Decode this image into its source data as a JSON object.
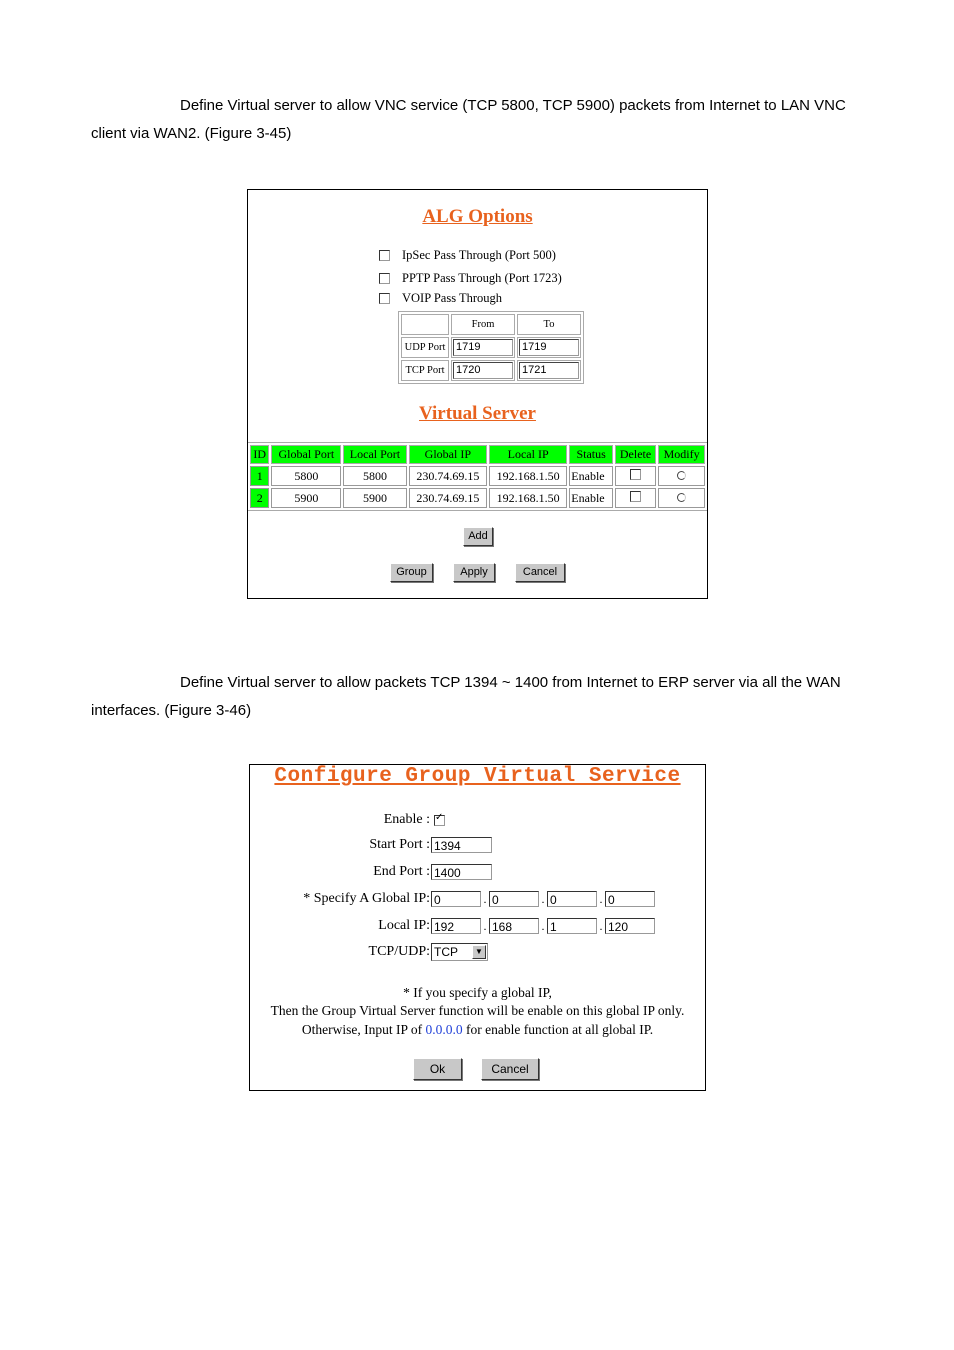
{
  "paragraphs": {
    "p1": "Define Virtual server to allow VNC service (TCP 5800, TCP 5900) packets from Internet to LAN VNC client via WAN2. (Figure 3-45)",
    "p2": "Define Virtual server to allow packets TCP 1394 ~ 1400 from Internet to ERP server via all the WAN interfaces. (Figure 3-46)"
  },
  "figure1": {
    "alg_title": "ALG Options",
    "options": [
      {
        "label": "IpSec Pass Through (Port 500)",
        "checked": false
      },
      {
        "label": "PPTP Pass Through (Port 1723)",
        "checked": false
      },
      {
        "label": "VOIP Pass Through",
        "checked": false
      }
    ],
    "voip_table": {
      "headers": [
        "",
        "From",
        "To"
      ],
      "rows": [
        {
          "label": "UDP Port",
          "from": "1719",
          "to": "1719"
        },
        {
          "label": "TCP Port",
          "from": "1720",
          "to": "1721"
        }
      ]
    },
    "vs_title": "Virtual Server",
    "vs_table": {
      "headers": [
        "ID",
        "Global Port",
        "Local Port",
        "Global IP",
        "Local IP",
        "Status",
        "Delete",
        "Modify"
      ],
      "rows": [
        {
          "id": "1",
          "global_port": "5800",
          "local_port": "5800",
          "global_ip": "230.74.69.15",
          "local_ip": "192.168.1.50",
          "status": "Enable"
        },
        {
          "id": "2",
          "global_port": "5900",
          "local_port": "5900",
          "global_ip": "230.74.69.15",
          "local_ip": "192.168.1.50",
          "status": "Enable"
        }
      ]
    },
    "buttons": {
      "add": "Add",
      "group": "Group",
      "apply": "Apply",
      "cancel": "Cancel"
    },
    "colors": {
      "title": "#e8621e",
      "header_bg": "#00ff00"
    }
  },
  "figure2": {
    "title": "Configure Group Virtual Service",
    "labels": {
      "enable": "Enable :",
      "start_port": "Start Port :",
      "end_port": "End Port :",
      "global_ip": "* Specify A Global IP:",
      "local_ip": "Local IP:",
      "protocol": "TCP/UDP:"
    },
    "values": {
      "enable": true,
      "start_port": "1394",
      "end_port": "1400",
      "global_ip": [
        "0",
        "0",
        "0",
        "0"
      ],
      "local_ip": [
        "192",
        "168",
        "1",
        "120"
      ],
      "protocol": "TCP"
    },
    "note": {
      "line1": "* If you specify a global IP,",
      "line2": "Then the Group Virtual Server function will be enable on this global IP only.",
      "line3_pre": "Otherwise, Input IP of ",
      "line3_ip": "0.0.0.0",
      "line3_post": " for enable function at all global IP."
    },
    "buttons": {
      "ok": "Ok",
      "cancel": "Cancel"
    }
  }
}
